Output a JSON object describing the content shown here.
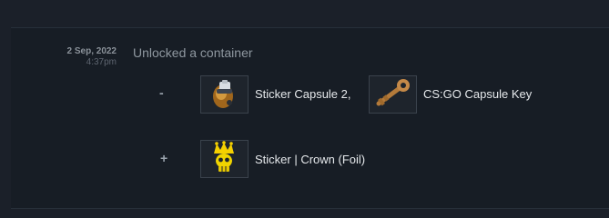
{
  "history_row": {
    "date": "2 Sep, 2022",
    "time": "4:37pm",
    "description": "Unlocked a container"
  },
  "items_lost": {
    "sign": "-",
    "items": [
      {
        "name": "Sticker Capsule 2,",
        "icon": "sticker-capsule-icon"
      },
      {
        "name": "CS:GO Capsule Key",
        "icon": "capsule-key-icon"
      }
    ]
  },
  "items_gained": {
    "sign": "+",
    "items": [
      {
        "name": "Sticker | Crown (Foil)",
        "icon": "crown-skull-sticker-icon"
      }
    ]
  },
  "colors": {
    "page_background": "#1b2029",
    "row_background": "#171d25",
    "item_name_text": "#e6e9ec",
    "muted_text": "#8f98a0"
  }
}
